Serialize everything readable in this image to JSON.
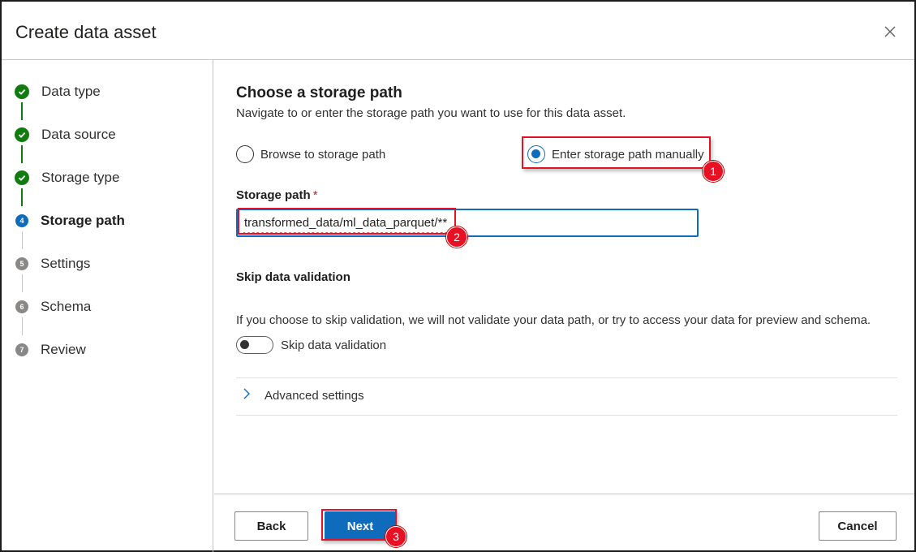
{
  "dialog": {
    "title": "Create data asset",
    "close_icon": "close-icon"
  },
  "colors": {
    "accent": "#0f6cbd",
    "done": "#107c10",
    "pending": "#8a8886",
    "annotation": "#e81123"
  },
  "steps": [
    {
      "label": "Data type",
      "status": "done",
      "badge": ""
    },
    {
      "label": "Data source",
      "status": "done",
      "badge": ""
    },
    {
      "label": "Storage type",
      "status": "done",
      "badge": ""
    },
    {
      "label": "Storage path",
      "status": "current",
      "badge": "4"
    },
    {
      "label": "Settings",
      "status": "pending",
      "badge": "5"
    },
    {
      "label": "Schema",
      "status": "pending",
      "badge": "6"
    },
    {
      "label": "Review",
      "status": "pending",
      "badge": "7"
    }
  ],
  "main": {
    "heading": "Choose a storage path",
    "subheading": "Navigate to or enter the storage path you want to use for this data asset.",
    "options": [
      {
        "label": "Browse to storage path",
        "selected": false
      },
      {
        "label": "Enter storage path manually",
        "selected": true
      }
    ],
    "storage_path": {
      "label": "Storage path",
      "required_mark": "*",
      "value": "transformed_data/ml_data_parquet/**"
    },
    "skip_validation": {
      "title": "Skip data validation",
      "description": "If you choose to skip validation, we will not validate your data path, or try to access your data for preview and schema.",
      "toggle_label": "Skip data validation",
      "enabled": false
    },
    "advanced": {
      "label": "Advanced settings",
      "icon": "chevron-right-icon"
    }
  },
  "footer": {
    "back_label": "Back",
    "next_label": "Next",
    "cancel_label": "Cancel"
  },
  "annotations": [
    "1",
    "2",
    "3"
  ]
}
